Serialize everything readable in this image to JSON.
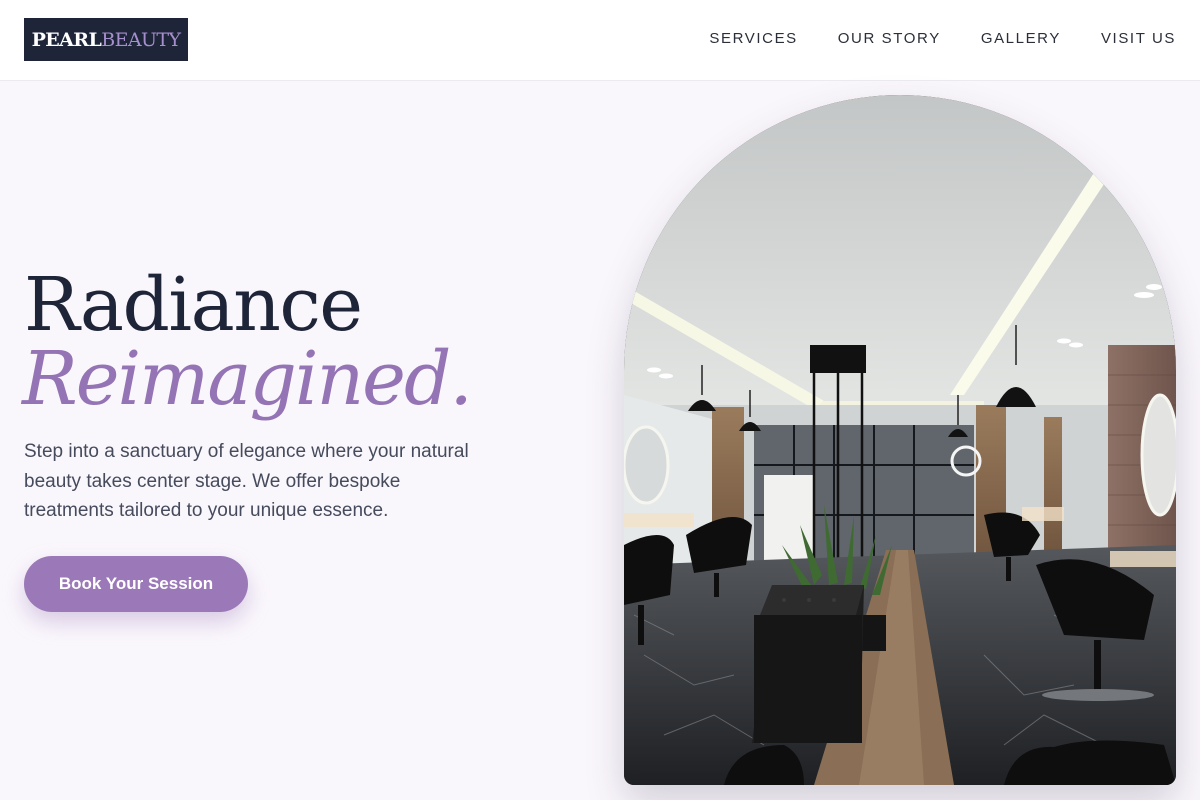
{
  "brand": {
    "logo_part1": "PEARL",
    "logo_part2": "BEAUTY",
    "colors": {
      "navy": "#1e2538",
      "lavender": "#9b79b8",
      "background": "#faf7fc"
    }
  },
  "nav": {
    "items": [
      {
        "label": "SERVICES"
      },
      {
        "label": "OUR STORY"
      },
      {
        "label": "GALLERY"
      },
      {
        "label": "VISIT US"
      }
    ]
  },
  "hero": {
    "title_line1": "Radiance",
    "title_line2": "Reimagined.",
    "description": "Step into a sanctuary of elegance where your natural beauty takes center stage. We offer bespoke treatments tailored to your unique essence.",
    "cta_label": "Book Your Session",
    "image_label": "salon-interior-photo"
  }
}
